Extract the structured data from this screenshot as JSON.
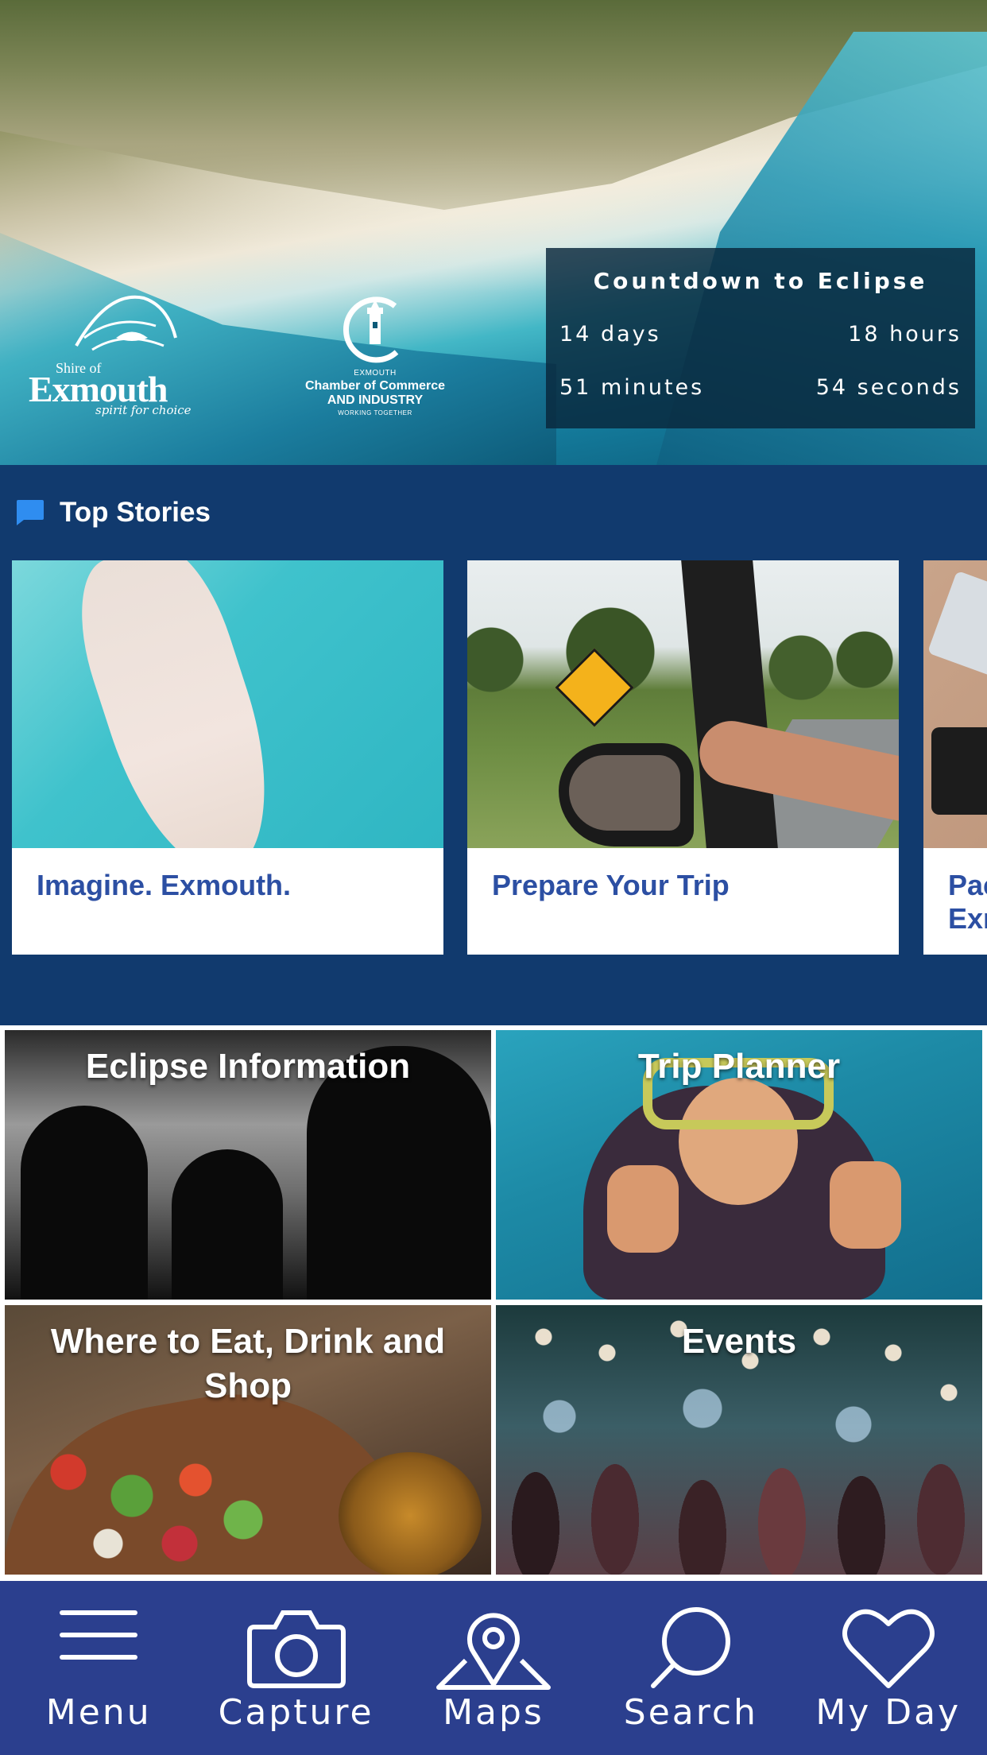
{
  "hero": {
    "shire_logo": {
      "small": "Shire of",
      "name": "Exmouth",
      "tagline": "spirit for choice"
    },
    "chamber_logo": {
      "small": "EXMOUTH",
      "line1": "Chamber of Commerce",
      "line2": "AND INDUSTRY",
      "tiny": "WORKING TOGETHER"
    },
    "countdown": {
      "title": "Countdown to Eclipse",
      "days": "14 days",
      "hours": "18 hours",
      "minutes": "51 minutes",
      "seconds": "54 seconds"
    }
  },
  "top_stories": {
    "heading": "Top Stories",
    "icon": "chat-bubble-icon",
    "cards": [
      {
        "label": "Imagine. Exmouth."
      },
      {
        "label": "Prepare Your Trip"
      },
      {
        "label": "Pac\nExm"
      }
    ]
  },
  "tiles": [
    {
      "title": "Eclipse Information"
    },
    {
      "title": "Trip Planner"
    },
    {
      "title": "Where to Eat, Drink and Shop"
    },
    {
      "title": "Events"
    }
  ],
  "nav": {
    "items": [
      {
        "label": "Menu",
        "icon": "menu-icon"
      },
      {
        "label": "Capture",
        "icon": "camera-icon"
      },
      {
        "label": "Maps",
        "icon": "map-pin-icon"
      },
      {
        "label": "Search",
        "icon": "search-icon"
      },
      {
        "label": "My Day",
        "icon": "heart-icon"
      }
    ]
  },
  "colors": {
    "stories_bg": "#113a6e",
    "card_text": "#2c4fa3",
    "nav_bg": "#2b3f8e",
    "accent_blue": "#2f8df0"
  }
}
